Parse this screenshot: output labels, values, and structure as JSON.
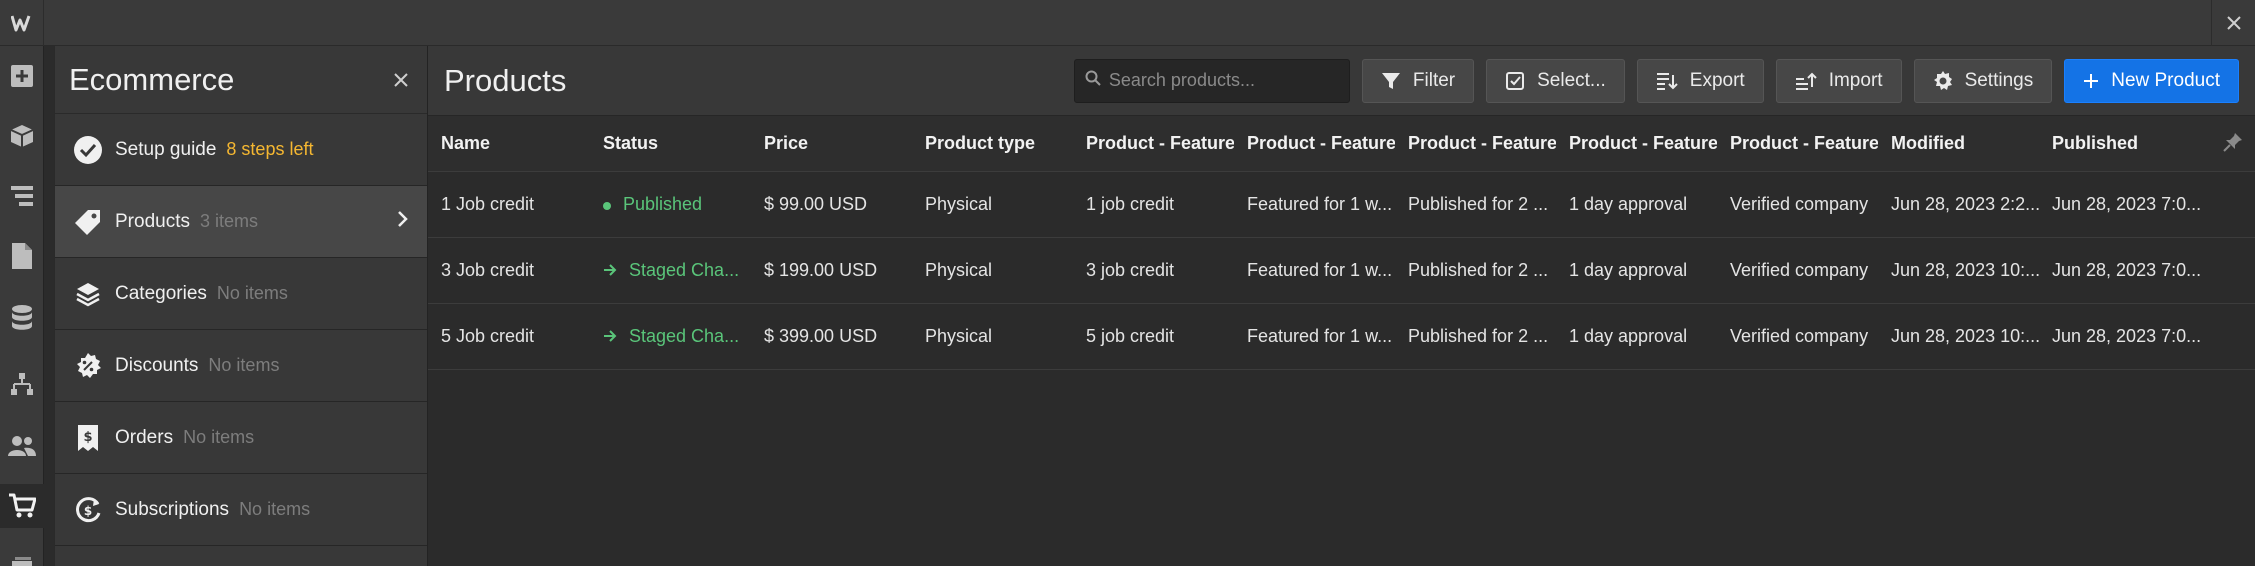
{
  "app": {
    "logo_letter": "W"
  },
  "colors": {
    "accent": "#1473e6",
    "published": "#5ac57a",
    "warning": "#f5b731"
  },
  "rail": {
    "icons": [
      "add-icon",
      "box-icon",
      "navigator-icon",
      "pages-icon",
      "cms-icon",
      "logic-icon",
      "users-icon",
      "ecommerce-icon",
      "assets-icon"
    ]
  },
  "panel": {
    "title": "Ecommerce",
    "items": [
      {
        "label": "Setup guide",
        "meta": "8 steps left",
        "icon": "check-circle-icon"
      },
      {
        "label": "Products",
        "meta": "3 items",
        "icon": "tag-icon"
      },
      {
        "label": "Categories",
        "meta": "No items",
        "icon": "category-icon"
      },
      {
        "label": "Discounts",
        "meta": "No items",
        "icon": "discount-icon"
      },
      {
        "label": "Orders",
        "meta": "No items",
        "icon": "receipt-icon"
      },
      {
        "label": "Subscriptions",
        "meta": "No items",
        "icon": "subscription-icon"
      }
    ]
  },
  "main": {
    "title": "Products",
    "search_placeholder": "Search products...",
    "buttons": {
      "filter": "Filter",
      "select": "Select...",
      "export": "Export",
      "import": "Import",
      "settings": "Settings",
      "new_product": "New Product"
    },
    "columns": [
      "Name",
      "Status",
      "Price",
      "Product type",
      "Product - Featured",
      "Product - Featured",
      "Product - Featured",
      "Product - Featured",
      "Product - Featured",
      "Modified",
      "Published"
    ],
    "rows": [
      {
        "name": "1 Job credit",
        "status": "Published",
        "status_icon": "dot-icon",
        "price": "$ 99.00 USD",
        "type": "Physical",
        "f1": "1 job credit",
        "f2": "Featured for 1 w...",
        "f3": "Published for 2 ...",
        "f4": "1 day approval",
        "f5": "Verified company",
        "modified": "Jun 28, 2023 2:2...",
        "published": "Jun 28, 2023 7:0..."
      },
      {
        "name": "3 Job credit",
        "status": "Staged Cha...",
        "status_icon": "arrow-right-icon",
        "price": "$ 199.00 USD",
        "type": "Physical",
        "f1": "3 job credit",
        "f2": "Featured for 1 w...",
        "f3": "Published for 2 ...",
        "f4": "1 day approval",
        "f5": "Verified company",
        "modified": "Jun 28, 2023 10:...",
        "published": "Jun 28, 2023 7:0..."
      },
      {
        "name": "5 Job credit",
        "status": "Staged Cha...",
        "status_icon": "arrow-right-icon",
        "price": "$ 399.00 USD",
        "type": "Physical",
        "f1": "5 job credit",
        "f2": "Featured for 1 w...",
        "f3": "Published for 2 ...",
        "f4": "1 day approval",
        "f5": "Verified company",
        "modified": "Jun 28, 2023 10:...",
        "published": "Jun 28, 2023 7:0..."
      }
    ]
  }
}
